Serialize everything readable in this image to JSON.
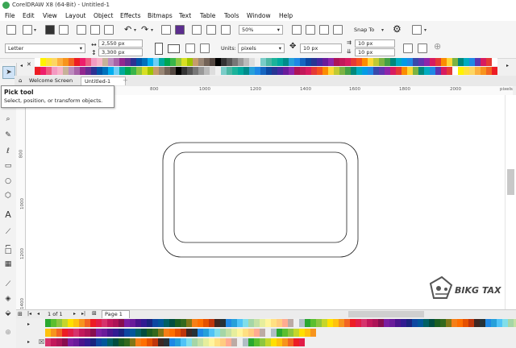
{
  "app": {
    "title": "CorelDRAW X8 (64-Bit) - Untitled-1"
  },
  "menu": [
    "File",
    "Edit",
    "View",
    "Layout",
    "Object",
    "Effects",
    "Bitmaps",
    "Text",
    "Table",
    "Tools",
    "Window",
    "Help"
  ],
  "toolbar": {
    "zoom": "50%",
    "snap_to": "Snap To",
    "icons": [
      "new-document-icon",
      "open-icon",
      "save-icon",
      "print-icon",
      "cut-icon",
      "copy-icon",
      "paste-icon",
      "undo-icon",
      "redo-icon",
      "search-content-icon",
      "import-icon",
      "export-icon",
      "publish-pdf-icon",
      "full-screen-icon",
      "show-rulers-icon",
      "show-grid-icon",
      "show-guidelines-icon",
      "options-icon",
      "launch-icon"
    ]
  },
  "properties": {
    "paper": "Letter",
    "width": "2,550 px",
    "height": "3,300 px",
    "units_label": "Units:",
    "units": "pixels",
    "nudge": "10 px",
    "dup_x": "10 px",
    "dup_y": "10 px"
  },
  "tabs": {
    "welcome": "Welcome Screen",
    "document": "Untitled-1"
  },
  "tooltip": {
    "title": "Pick tool",
    "desc": "Select, position, or transform objects."
  },
  "ruler": {
    "h_labels": [
      "800",
      "1000",
      "1200",
      "1400",
      "1600",
      "1800",
      "2000",
      "pixels"
    ],
    "v_labels": [
      "800",
      "1000",
      "1200",
      "1400"
    ]
  },
  "tools": [
    "pick-tool-icon",
    "shape-tool-icon",
    "crop-tool-icon",
    "zoom-tool-icon",
    "freehand-tool-icon",
    "artistic-media-icon",
    "rectangle-tool-icon",
    "ellipse-tool-icon",
    "polygon-tool-icon",
    "text-tool-icon",
    "parallel-dimension-icon",
    "connector-tool-icon",
    "drop-shadow-icon",
    "transparency-icon",
    "eyedropper-icon",
    "interactive-fill-icon",
    "smart-fill-icon"
  ],
  "page_nav": {
    "counter": "1  of  1",
    "page_tab": "Page 1"
  },
  "watermark": "BIKG TAX",
  "colors": {
    "accent": "#3aa655",
    "top_palette": [
      "#ffffff",
      "#fff200",
      "#ffe13b",
      "#fdd663",
      "#fcb040",
      "#f7941d",
      "#f26522",
      "#ed1c24",
      "#ee1d6b",
      "#ed5b80",
      "#f49ac2",
      "#f7b3c8",
      "#c7b299",
      "#bd8cbf",
      "#a864a8",
      "#92278f",
      "#662d91",
      "#2e3192",
      "#0054a6",
      "#0072bc",
      "#00aeef",
      "#6dcff6",
      "#00a99d",
      "#00a651",
      "#39b54a",
      "#8dc63f",
      "#d7df23",
      "#a0c400",
      "#c69c6d",
      "#998675",
      "#736357",
      "#534741",
      "#000000",
      "#333333",
      "#555555",
      "#777777",
      "#999999",
      "#bbbbbb",
      "#dddddd",
      "#f0f0f0",
      "#7accc8",
      "#4db7a4",
      "#1bb39a",
      "#00a99d",
      "#008b8b",
      "#26a0da",
      "#1e88e5",
      "#1565c0",
      "#0d47a1",
      "#283593",
      "#4527a0",
      "#6a1b9a",
      "#8e24aa",
      "#ad1457",
      "#c2185b",
      "#d81b60",
      "#e53935",
      "#f4511e",
      "#fb8c00",
      "#fdd835",
      "#c0ca33",
      "#7cb342",
      "#43a047",
      "#00897b",
      "#00acc1",
      "#039be5",
      "#1e88e5",
      "#3949ab",
      "#5e35b1",
      "#8e24aa",
      "#d81b60",
      "#e53935",
      "#fb8c00",
      "#fdd835",
      "#7cb342",
      "#00897b",
      "#00acc1",
      "#1e88e5",
      "#5e35b1",
      "#d81b60",
      "#e53935"
    ],
    "bottom_palette": [
      "#2aa830",
      "#5bbf2f",
      "#8dc63f",
      "#c5d62b",
      "#ffe000",
      "#ffc20e",
      "#f7941d",
      "#f26522",
      "#ed1c24",
      "#e11d48",
      "#d6336c",
      "#c2185b",
      "#ad1457",
      "#880e4f",
      "#7b1fa2",
      "#6a1b9a",
      "#4a148c",
      "#311b92",
      "#1a237e",
      "#0d47a1",
      "#01579b",
      "#006064",
      "#004d40",
      "#1b5e20",
      "#33691e",
      "#827717",
      "#f57f17",
      "#ff6f00",
      "#e65100",
      "#bf360c",
      "#3e2723",
      "#263238",
      "#1e88e5",
      "#26a0da",
      "#4fc3f7",
      "#80deea",
      "#a5d6a7",
      "#c5e1a5",
      "#e6ee9c",
      "#fff59d",
      "#ffe082",
      "#ffcc80",
      "#ffab91",
      "#bcaaa4",
      "#eeeeee",
      "#b0bec5"
    ]
  }
}
